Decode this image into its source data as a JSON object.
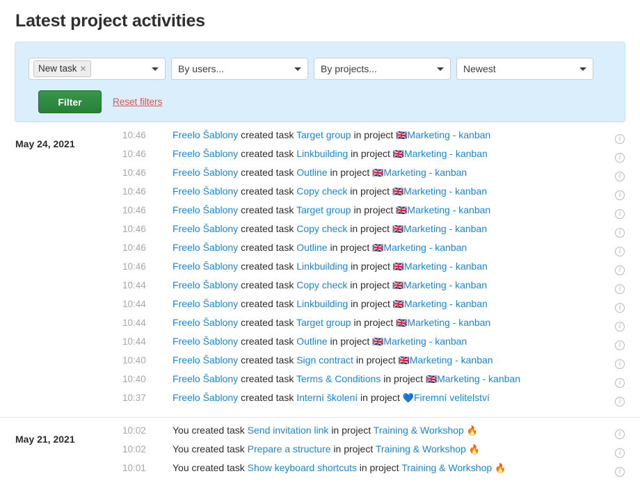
{
  "header": {
    "title": "Latest project activities"
  },
  "filters": {
    "panel_bg": "#dbeefb",
    "type_select": {
      "chip_label": "New task",
      "chip_remove": "✕"
    },
    "users_select": {
      "value": "By users..."
    },
    "projects_select": {
      "value": "By projects..."
    },
    "sort_select": {
      "value": "Newest"
    },
    "filter_button": "Filter",
    "reset_link": "Reset filters",
    "link_color": "#d9534f",
    "button_color": "#2e8b3d"
  },
  "icons": {
    "caret": "▾",
    "info": "i"
  },
  "activity": {
    "groups": [
      {
        "date": "May 24, 2021",
        "rows": [
          {
            "time": "10:46",
            "actor": "Freelo Šablony",
            "actor_link": true,
            "verb": "created task",
            "task": "Target group",
            "mid": "in project",
            "project_emoji": "🇬🇧",
            "emoji_position": "before",
            "project": "Marketing - kanban"
          },
          {
            "time": "10:46",
            "actor": "Freelo Šablony",
            "actor_link": true,
            "verb": "created task",
            "task": "Linkbuilding",
            "mid": "in project",
            "project_emoji": "🇬🇧",
            "emoji_position": "before",
            "project": "Marketing - kanban"
          },
          {
            "time": "10:46",
            "actor": "Freelo Šablony",
            "actor_link": true,
            "verb": "created task",
            "task": "Outline",
            "mid": "in project",
            "project_emoji": "🇬🇧",
            "emoji_position": "before",
            "project": "Marketing - kanban"
          },
          {
            "time": "10:46",
            "actor": "Freelo Šablony",
            "actor_link": true,
            "verb": "created task",
            "task": "Copy check",
            "mid": "in project",
            "project_emoji": "🇬🇧",
            "emoji_position": "before",
            "project": "Marketing - kanban"
          },
          {
            "time": "10:46",
            "actor": "Freelo Šablony",
            "actor_link": true,
            "verb": "created task",
            "task": "Target group",
            "mid": "in project",
            "project_emoji": "🇬🇧",
            "emoji_position": "before",
            "project": "Marketing - kanban"
          },
          {
            "time": "10:46",
            "actor": "Freelo Šablony",
            "actor_link": true,
            "verb": "created task",
            "task": "Copy check",
            "mid": "in project",
            "project_emoji": "🇬🇧",
            "emoji_position": "before",
            "project": "Marketing - kanban"
          },
          {
            "time": "10:46",
            "actor": "Freelo Šablony",
            "actor_link": true,
            "verb": "created task",
            "task": "Outline",
            "mid": "in project",
            "project_emoji": "🇬🇧",
            "emoji_position": "before",
            "project": "Marketing - kanban"
          },
          {
            "time": "10:46",
            "actor": "Freelo Šablony",
            "actor_link": true,
            "verb": "created task",
            "task": "Linkbuilding",
            "mid": "in project",
            "project_emoji": "🇬🇧",
            "emoji_position": "before",
            "project": "Marketing - kanban"
          },
          {
            "time": "10:44",
            "actor": "Freelo Šablony",
            "actor_link": true,
            "verb": "created task",
            "task": "Copy check",
            "mid": "in project",
            "project_emoji": "🇬🇧",
            "emoji_position": "before",
            "project": "Marketing - kanban"
          },
          {
            "time": "10:44",
            "actor": "Freelo Šablony",
            "actor_link": true,
            "verb": "created task",
            "task": "Linkbuilding",
            "mid": "in project",
            "project_emoji": "🇬🇧",
            "emoji_position": "before",
            "project": "Marketing - kanban"
          },
          {
            "time": "10:44",
            "actor": "Freelo Šablony",
            "actor_link": true,
            "verb": "created task",
            "task": "Target group",
            "mid": "in project",
            "project_emoji": "🇬🇧",
            "emoji_position": "before",
            "project": "Marketing - kanban"
          },
          {
            "time": "10:44",
            "actor": "Freelo Šablony",
            "actor_link": true,
            "verb": "created task",
            "task": "Outline",
            "mid": "in project",
            "project_emoji": "🇬🇧",
            "emoji_position": "before",
            "project": "Marketing - kanban"
          },
          {
            "time": "10:40",
            "actor": "Freelo Šablony",
            "actor_link": true,
            "verb": "created task",
            "task": "Sign contract",
            "mid": "in project",
            "project_emoji": "🇬🇧",
            "emoji_position": "before",
            "project": "Marketing - kanban"
          },
          {
            "time": "10:40",
            "actor": "Freelo Šablony",
            "actor_link": true,
            "verb": "created task",
            "task": "Terms & Conditions",
            "mid": "in project",
            "project_emoji": "🇬🇧",
            "emoji_position": "before",
            "project": "Marketing - kanban"
          },
          {
            "time": "10:37",
            "actor": "Freelo Šablony",
            "actor_link": true,
            "verb": "created task",
            "task": "Interní školení",
            "mid": "in project",
            "project_emoji": "💙",
            "emoji_position": "before",
            "project": "Firemní velitelství"
          }
        ]
      },
      {
        "date": "May 21, 2021",
        "rows": [
          {
            "time": "10:02",
            "actor": "You",
            "actor_link": false,
            "verb": "created task",
            "task": "Send invitation link",
            "mid": "in project",
            "project_emoji": "🔥",
            "emoji_position": "after",
            "project": "Training & Workshop"
          },
          {
            "time": "10:02",
            "actor": "You",
            "actor_link": false,
            "verb": "created task",
            "task": "Prepare a structure",
            "mid": "in project",
            "project_emoji": "🔥",
            "emoji_position": "after",
            "project": "Training & Workshop"
          },
          {
            "time": "10:01",
            "actor": "You",
            "actor_link": false,
            "verb": "created task",
            "task": "Show keyboard shortcuts",
            "mid": "in project",
            "project_emoji": "🔥",
            "emoji_position": "after",
            "project": "Training & Workshop"
          }
        ]
      }
    ]
  }
}
